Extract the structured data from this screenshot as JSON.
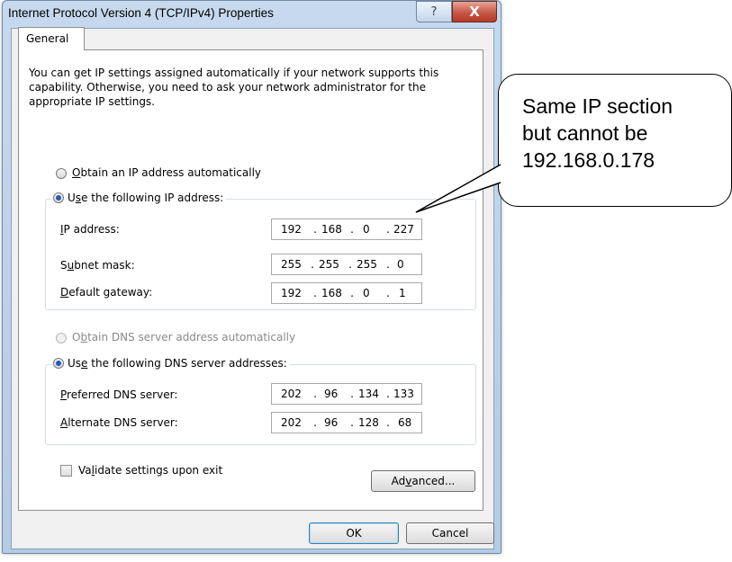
{
  "window": {
    "title": "Internet Protocol Version 4 (TCP/IPv4) Properties",
    "help_symbol": "?",
    "close_symbol": "X"
  },
  "tabs": [
    {
      "label": "General",
      "selected": true
    }
  ],
  "intro_text": "You can get IP settings assigned automatically if your network supports this capability. Otherwise, you need to ask your network administrator for the appropriate IP settings.",
  "ip_section": {
    "auto_option": {
      "label": "Obtain an IP address automatically",
      "checked": false
    },
    "manual_option": {
      "label": "Use the following IP address:",
      "checked": true
    },
    "fields": [
      {
        "label": "IP address:",
        "octets": [
          "192",
          "168",
          "0",
          "227"
        ]
      },
      {
        "label": "Subnet mask:",
        "octets": [
          "255",
          "255",
          "255",
          "0"
        ]
      },
      {
        "label": "Default gateway:",
        "octets": [
          "192",
          "168",
          "0",
          "1"
        ]
      }
    ]
  },
  "dns_section": {
    "auto_option": {
      "label": "Obtain DNS server address automatically",
      "checked": false,
      "disabled": true
    },
    "manual_option": {
      "label": "Use the following DNS server addresses:",
      "checked": true
    },
    "fields": [
      {
        "label": "Preferred DNS server:",
        "octets": [
          "202",
          "96",
          "134",
          "133"
        ]
      },
      {
        "label": "Alternate DNS server:",
        "octets": [
          "202",
          "96",
          "128",
          "68"
        ]
      }
    ]
  },
  "validate_checkbox": {
    "label": "Validate settings upon exit",
    "checked": false
  },
  "buttons": {
    "advanced": "Advanced...",
    "ok": "OK",
    "cancel": "Cancel"
  },
  "callout": {
    "lines": [
      "Same IP section",
      "but cannot be",
      "192.168.0.178"
    ]
  },
  "colors": {
    "title_bar": "#c6d9ee",
    "close_button": "#c75745",
    "panel": "#ffffff",
    "client": "#f0f0f0"
  }
}
